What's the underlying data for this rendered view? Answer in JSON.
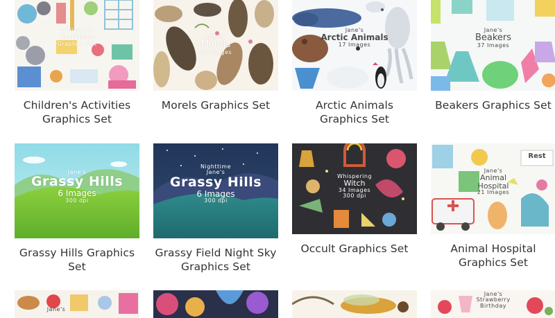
{
  "products": [
    {
      "title": "Children's Activities Graphics Set",
      "thumb_text": [
        "Children's",
        "Activities",
        "Graphics Set"
      ]
    },
    {
      "title": "Morels Graphics Set",
      "thumb_text": [
        "Jane's",
        "Morels",
        "33 Images"
      ]
    },
    {
      "title": "Arctic Animals Graphics Set",
      "thumb_text": [
        "Jane's",
        "Arctic Animals",
        "17 Images"
      ]
    },
    {
      "title": "Beakers Graphics Set",
      "thumb_text": [
        "Jane's",
        "Beakers",
        "37 Images"
      ]
    },
    {
      "title": "Grassy Hills Graphics Set",
      "thumb_text": [
        "Jane's",
        "Grassy Hills",
        "6 Images",
        "300 dpi"
      ]
    },
    {
      "title": "Grassy Field Night Sky Graphics Set",
      "thumb_text": [
        "Nighttime",
        "Jane's",
        "Grassy Hills",
        "6 Images",
        "300 dpi"
      ]
    },
    {
      "title": "Occult Graphics Set",
      "thumb_text": [
        "Whispering",
        "Witch",
        "34 Images",
        "300 dpi"
      ]
    },
    {
      "title": "Animal Hospital Graphics Set",
      "thumb_text": [
        "Jane's",
        "Animal",
        "Hospital",
        "21 Images",
        "Rest"
      ]
    },
    {
      "title": "",
      "thumb_text": [
        "Jane's"
      ]
    },
    {
      "title": "",
      "thumb_text": []
    },
    {
      "title": "",
      "thumb_text": []
    },
    {
      "title": "",
      "thumb_text": [
        "Jane's",
        "Strawberry",
        "Birthday"
      ]
    }
  ]
}
